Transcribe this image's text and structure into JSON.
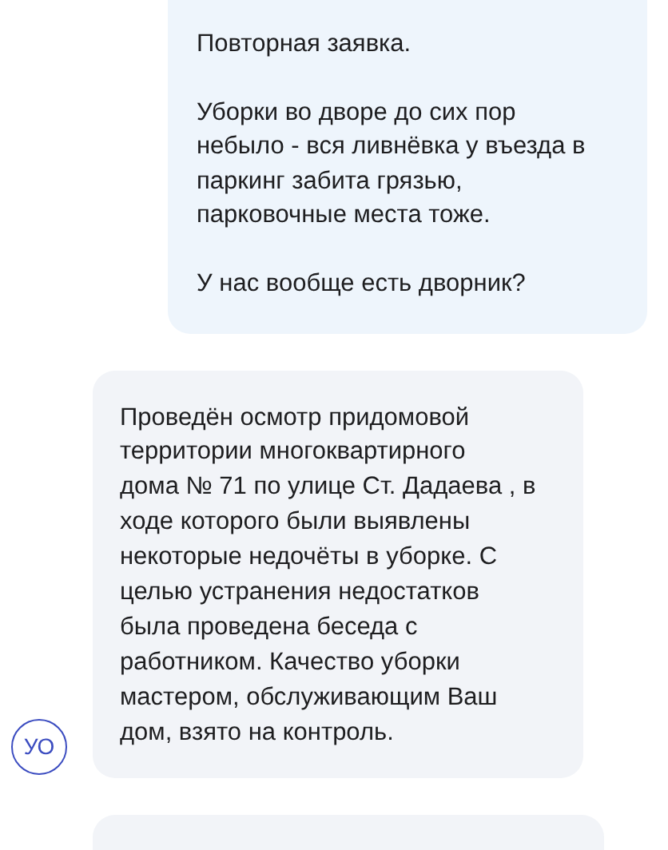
{
  "messages": [
    {
      "kind": "outgoing",
      "paragraphs": [
        "Повторная заявка.",
        "Уборки во дворе до сих пор\nнебыло - вся ливнёвка у въезда в\nпаркинг забита грязью,\nпарковочные места тоже.",
        "У нас вообще есть дворник?"
      ]
    },
    {
      "kind": "incoming",
      "avatar": "УО",
      "paragraphs": [
        "Проведён осмотр придомовой\nтерритории многоквартирного\nдома № 71 по улице Ст. Дадаева , в\nходе которого были выявлены\nнекоторые недочёты в уборке. С\nцелью устранения недостатков\nбыла проведена беседа с\nработником. Качество уборки\nмастером, обслуживающим Ваш\nдом, взято на контроль."
      ]
    },
    {
      "kind": "incoming_partial"
    }
  ]
}
